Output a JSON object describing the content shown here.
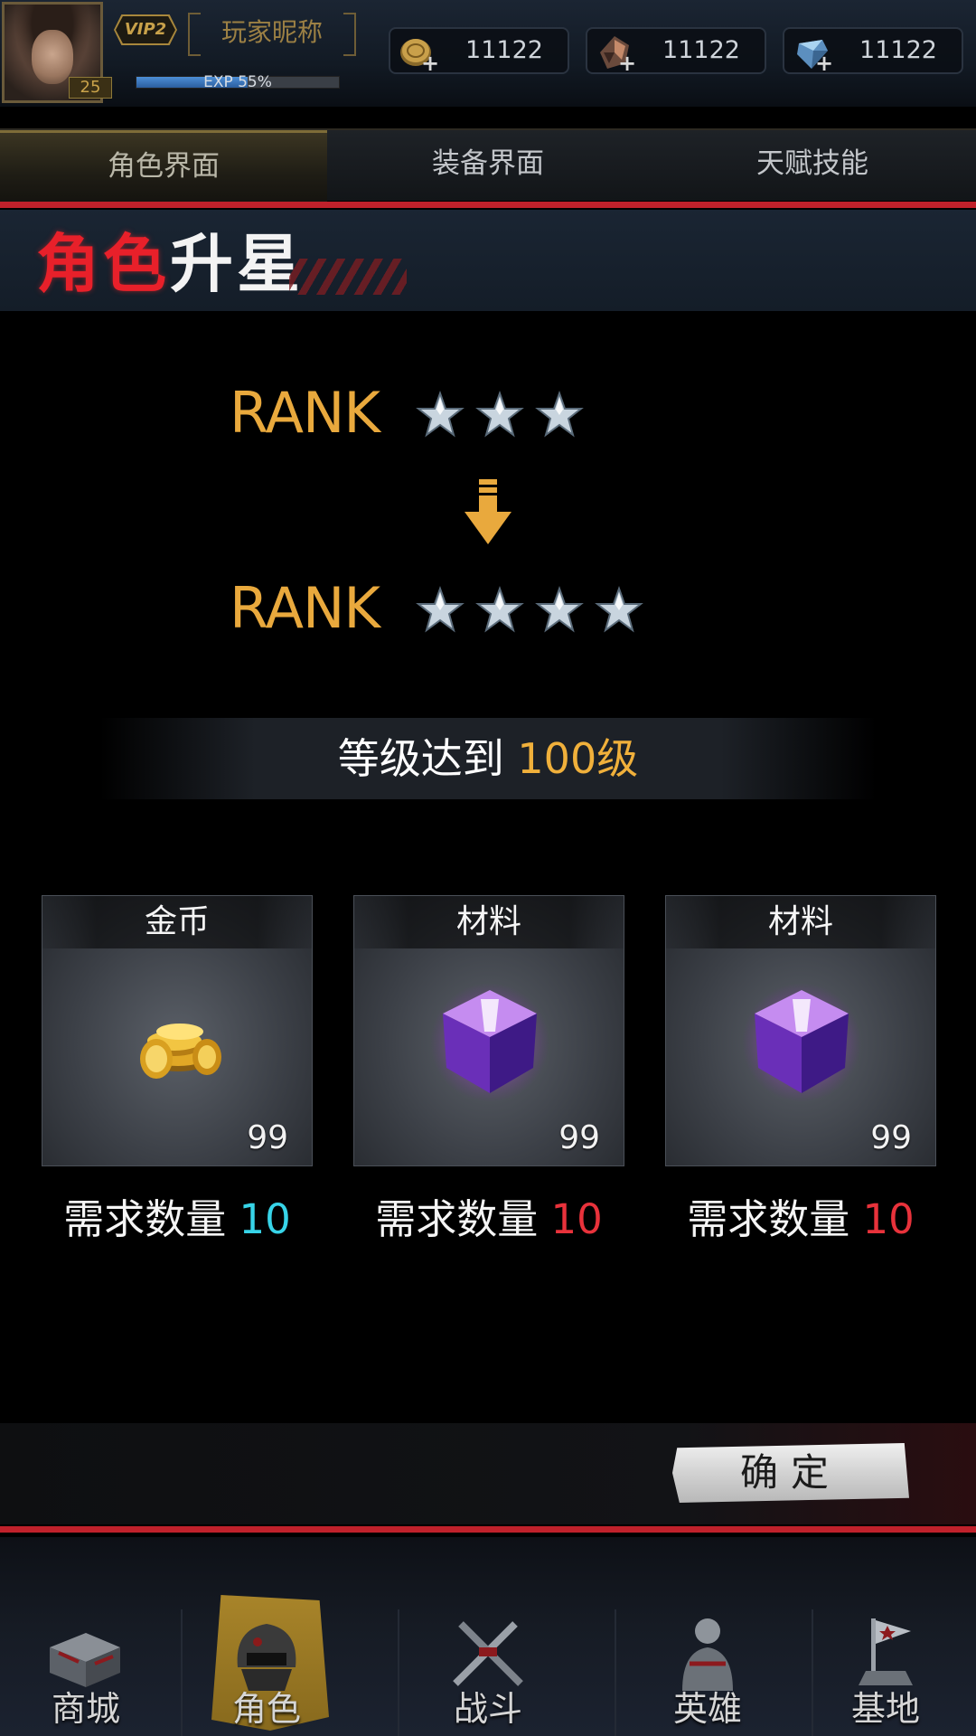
{
  "header": {
    "player_level": "25",
    "vip": "VIP2",
    "nickname": "玩家昵称",
    "exp_label": "EXP 55%",
    "exp_fraction": 0.55,
    "currencies": [
      {
        "name": "gold-coin",
        "amount": "11122"
      },
      {
        "name": "material-ore",
        "amount": "11122"
      },
      {
        "name": "diamond",
        "amount": "11122"
      }
    ]
  },
  "tabs": [
    {
      "label": "角色界面",
      "active": true
    },
    {
      "label": "装备界面",
      "active": false
    },
    {
      "label": "天赋技能",
      "active": false
    }
  ],
  "banner": {
    "title_red": "角色",
    "title_white": "升星"
  },
  "rank": {
    "label": "RANK",
    "current_stars": 3,
    "next_stars": 4
  },
  "requirement": {
    "prefix": "等级达到 ",
    "value": "100级"
  },
  "materials": [
    {
      "title": "金币",
      "count": "99",
      "need_label": "需求数量 ",
      "need_value": "10",
      "need_color": "#37d4e8",
      "icon": "gold-coins-icon"
    },
    {
      "title": "材料",
      "count": "99",
      "need_label": "需求数量 ",
      "need_value": "10",
      "need_color": "#e8323b",
      "icon": "purple-crystal-icon"
    },
    {
      "title": "材料",
      "count": "99",
      "need_label": "需求数量 ",
      "need_value": "10",
      "need_color": "#e8323b",
      "icon": "purple-crystal-icon"
    }
  ],
  "confirm_label": "确定",
  "bottom_nav": [
    {
      "label": "商城",
      "icon": "shop-crate-icon",
      "active": false
    },
    {
      "label": "角色",
      "icon": "helmet-character-icon",
      "active": true
    },
    {
      "label": "战斗",
      "icon": "crossed-rifles-icon",
      "active": false
    },
    {
      "label": "英雄",
      "icon": "soldier-hero-icon",
      "active": false
    },
    {
      "label": "基地",
      "icon": "flag-base-icon",
      "active": false
    }
  ],
  "colors": {
    "accent_gold": "#e9a93d",
    "accent_red": "#c0212b",
    "cyan": "#37d4e8"
  }
}
